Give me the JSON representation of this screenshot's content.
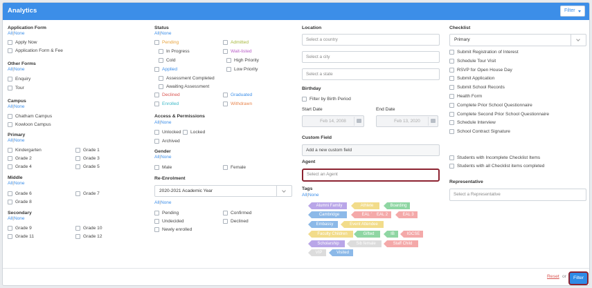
{
  "header": {
    "title": "Analytics",
    "filter_button": "Filter"
  },
  "all": "All",
  "none": "None",
  "sep": "|",
  "col1": {
    "application_form": {
      "title": "Application Form",
      "items": [
        "Apply Now",
        "Application Form & Fee"
      ]
    },
    "other_forms": {
      "title": "Other Forms",
      "items": [
        "Enquiry",
        "Tour"
      ]
    },
    "campus": {
      "title": "Campus",
      "items": [
        "Chatham Campus",
        "Kowloon Campus"
      ]
    },
    "primary": {
      "title": "Primary",
      "left": [
        "Kindergarten",
        "Grade 2",
        "Grade 4"
      ],
      "right": [
        "Grade 1",
        "Grade 3",
        "Grade 5"
      ]
    },
    "middle": {
      "title": "Middle",
      "left": [
        "Grade 6",
        "Grade 8"
      ],
      "right": [
        "Grade 7"
      ]
    },
    "secondary": {
      "title": "Secondary",
      "left": [
        "Grade 9",
        "Grade 11"
      ],
      "right": [
        "Grade 10",
        "Grade 12"
      ]
    }
  },
  "col2": {
    "status": {
      "title": "Status",
      "items": {
        "pending": "Pending",
        "in_progress": "In Progress",
        "cold": "Cold",
        "applied": "Applied",
        "assessment_completed": "Assessment Completed",
        "awaiting_assessment": "Awaiting Assessment",
        "declined": "Declined",
        "enrolled": "Enrolled",
        "admitted": "Admitted",
        "wait_listed": "Wait-listed",
        "high_priority": "High Priority",
        "low_priority": "Low Priority",
        "graduated": "Graduated",
        "withdrawn": "Withdrawn"
      }
    },
    "access": {
      "title": "Access & Permissions",
      "items": [
        "Unlocked",
        "Locked",
        "Archived"
      ]
    },
    "gender": {
      "title": "Gender",
      "items": [
        "Male",
        "Female"
      ]
    },
    "re_enrolment": {
      "title": "Re-Enrolment",
      "year": "2020-2021 Academic Year",
      "items": {
        "pending": "Pending",
        "confirmed": "Confirmed",
        "undecided": "Undecided",
        "declined": "Declined",
        "newly_enrolled": "Newly enrolled"
      }
    }
  },
  "col3": {
    "location": {
      "title": "Location",
      "country_placeholder": "Select a country",
      "city_placeholder": "Select a city",
      "state_placeholder": "Select a state"
    },
    "birthday": {
      "title": "Birthday",
      "filter_label": "Filter by Birth Period",
      "start_label": "Start Date",
      "end_label": "End Date",
      "start_value": "Feb 14, 2008",
      "end_value": "Feb 13, 2020"
    },
    "custom_field": {
      "title": "Custom Field",
      "add_label": "Add a new custom field"
    },
    "agent": {
      "title": "Agent",
      "placeholder": "Select an Agent"
    },
    "tags": {
      "title": "Tags",
      "items": [
        {
          "label": "Alumni Family",
          "color": "#b9a6e8"
        },
        {
          "label": "Athlete",
          "color": "#f2dc8a"
        },
        {
          "label": "Boarding",
          "color": "#8fd6a3"
        },
        {
          "label": "Cambridge",
          "color": "#8cb9e8"
        },
        {
          "label": "EAL 1",
          "color": "#f4a9a9"
        },
        {
          "label": "EAL 2",
          "color": "#f4a9a9"
        },
        {
          "label": "EAL 3",
          "color": "#f4a9a9"
        },
        {
          "label": "Embassy",
          "color": "#8cb9e8"
        },
        {
          "label": "Event Attendee",
          "color": "#f2dc8a"
        },
        {
          "label": "Faculty Children",
          "color": "#f2dc8a"
        },
        {
          "label": "Gifted",
          "color": "#8fd6a3"
        },
        {
          "label": "IB",
          "color": "#8fd6a3"
        },
        {
          "label": "IGCSE",
          "color": "#f4a9a9"
        },
        {
          "label": "Scholarship",
          "color": "#b9a6e8"
        },
        {
          "label": "Sib female",
          "color": "#dcdcdc"
        },
        {
          "label": "Staff Child",
          "color": "#f4a9a9"
        },
        {
          "label": "VIP",
          "color": "#dcdcdc"
        },
        {
          "label": "Visited",
          "color": "#8cb9e8"
        }
      ]
    }
  },
  "col4": {
    "checklist": {
      "title": "Checklist",
      "selected": "Primary",
      "items": [
        "Submit Registration of Interest",
        "Schedule Tour Visit",
        "RSVP for Open House Day",
        "Submit Application",
        "Submit School Records",
        "Health Form",
        "Complete Prior School Questionnaire",
        "Complete Second Prior School Questionnaire",
        "Schedule Interview",
        "School Contract Signature"
      ],
      "extra": [
        "Students with Incomplete Checklist Items",
        "Students with all Checklist items completed"
      ]
    },
    "representative": {
      "title": "Representative",
      "placeholder": "Select a Representative"
    }
  },
  "status_colors": {
    "pending": "#e8a33c",
    "admitted": "#a6b83c",
    "wait_listed": "#b75ac7",
    "applied": "#3c8ee8",
    "declined": "#d9534f",
    "enrolled": "#3cb8c7",
    "graduated": "#3c8ee8",
    "withdrawn": "#e8844c"
  },
  "footer": {
    "reset": "Reset",
    "or": "or",
    "filter": "Filter"
  }
}
